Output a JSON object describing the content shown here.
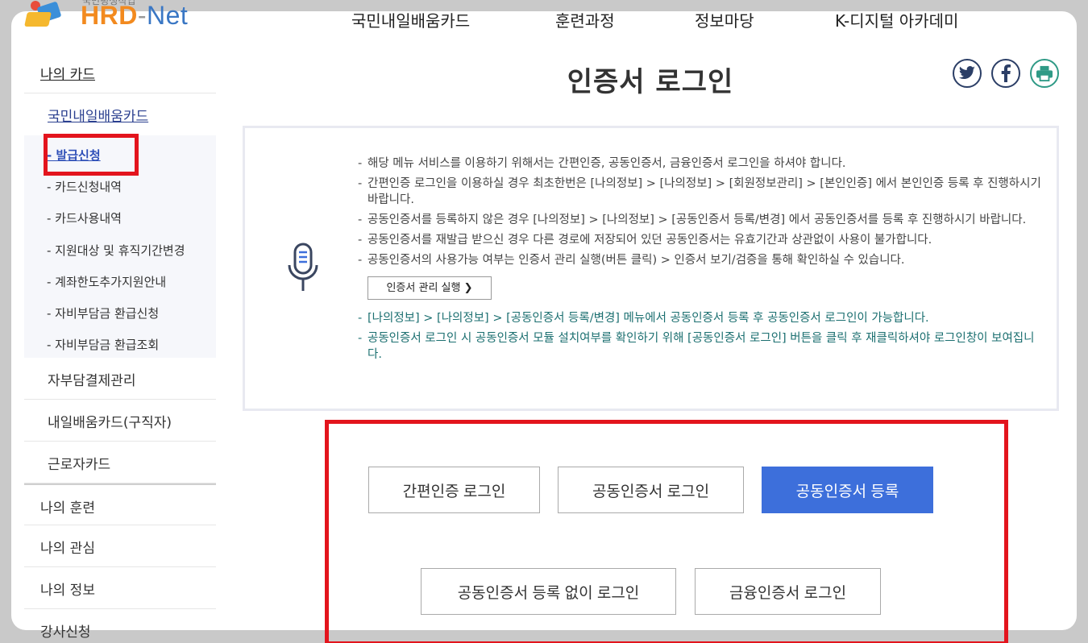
{
  "logo": {
    "tagline": "국민평생직업",
    "brand_hrd": "HRD",
    "brand_dash": "-",
    "brand_net": "Net"
  },
  "gnb": [
    "국민내일배움카드",
    "훈련과정",
    "정보마당",
    "K-디지털 아카데미"
  ],
  "sidebar": {
    "top": "나의 카드",
    "sub": "국민내일배움카드",
    "items": [
      "- 발급신청",
      "- 카드신청내역",
      "- 카드사용내역",
      "- 지원대상 및 휴직기간변경",
      "- 계좌한도추가지원안내",
      "- 자비부담금 환급신청",
      "- 자비부담금 환급조회"
    ],
    "groups": [
      "자부담결제관리",
      "내일배움카드(구직자)",
      "근로자카드"
    ],
    "mains": [
      "나의 훈련",
      "나의 관심",
      "나의 정보",
      "강사신청"
    ]
  },
  "page_title": "인증서 로그인",
  "social": [
    "twitter-icon",
    "facebook-icon",
    "print-icon"
  ],
  "notice": {
    "items": [
      "해당 메뉴 서비스를 이용하기 위해서는 간편인증, 공동인증서, 금융인증서 로그인을 하셔야 합니다.",
      "간편인증 로그인을 이용하실 경우 최초한번은 [나의정보] > [나의정보] > [회원정보관리] > [본인인증] 에서 본인인증 등록 후 진행하시기 바랍니다.",
      "공동인증서를 등록하지 않은 경우 [나의정보] > [나의정보] > [공동인증서 등록/변경] 에서 공동인증서를 등록 후 진행하시기 바랍니다.",
      "공동인증서를 재발급 받으신 경우 다른 경로에 저장되어 있던 공동인증서는 유효기간과 상관없이 사용이 불가합니다.",
      "공동인증서의 사용가능 여부는 인증서 관리 실행(버튼 클릭) > 인증서 보기/검증을 통해 확인하실 수 있습니다."
    ],
    "cert_button": "인증서 관리 실행",
    "teal_items": [
      "[나의정보] > [나의정보] > [공동인증서 등록/변경] 메뉴에서 공동인증서 등록 후 공동인증서 로그인이 가능합니다.",
      "공동인증서 로그인 시 공동인증서 모듈 설치여부를 확인하기 위해 [공동인증서 로그인] 버튼을 클릭 후 재클릭하셔야 로그인창이 보여집니다."
    ]
  },
  "buttons": {
    "simple": "간편인증 로그인",
    "joint": "공동인증서 로그인",
    "register": "공동인증서 등록",
    "joint_noreg": "공동인증서 등록 없이 로그인",
    "finance": "금융인증서 로그인"
  },
  "colors": {
    "primary": "#3d6fdb",
    "highlight": "#e3141d",
    "teal": "#1b6f70"
  }
}
